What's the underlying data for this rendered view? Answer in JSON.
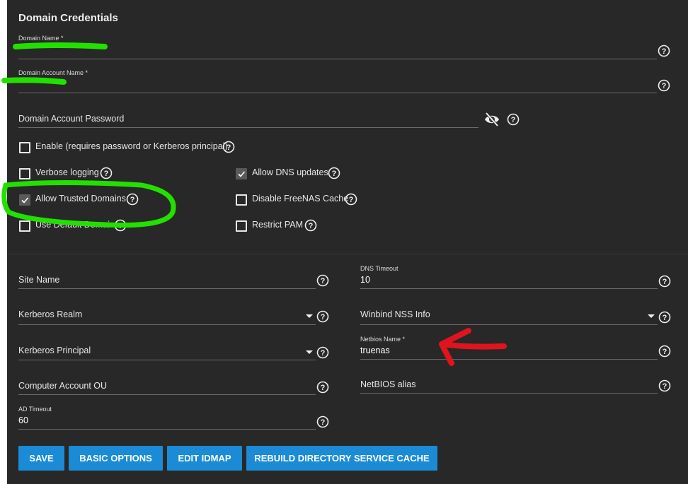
{
  "section": {
    "title": "Domain Credentials"
  },
  "fields": {
    "domain_name": {
      "label": "Domain Name *",
      "value": ""
    },
    "domain_account_name": {
      "label": "Domain Account Name *",
      "value": ""
    },
    "domain_account_password": {
      "label": "Domain Account Password",
      "value": ""
    },
    "site_name": {
      "label": "Site Name",
      "value": ""
    },
    "dns_timeout": {
      "label": "DNS Timeout",
      "value": "10"
    },
    "kerberos_realm": {
      "label": "Kerberos Realm",
      "value": ""
    },
    "winbind_nss_info": {
      "label": "Winbind NSS Info",
      "value": ""
    },
    "kerberos_principal": {
      "label": "Kerberos Principal",
      "value": ""
    },
    "netbios_name": {
      "label": "Netbios Name *",
      "value": "truenas"
    },
    "computer_account_ou": {
      "label": "Computer Account OU",
      "value": ""
    },
    "netbios_alias": {
      "label": "NetBIOS alias",
      "value": ""
    },
    "ad_timeout": {
      "label": "AD Timeout",
      "value": "60"
    }
  },
  "checkboxes": {
    "enable": {
      "label": "Enable (requires password or Kerberos principal)",
      "checked": false
    },
    "verbose_logging": {
      "label": "Verbose logging",
      "checked": false
    },
    "allow_dns_updates": {
      "label": "Allow DNS updates",
      "checked": true
    },
    "allow_trusted_domains": {
      "label": "Allow Trusted Domains",
      "checked": true
    },
    "disable_freenas_cache": {
      "label": "Disable FreeNAS Cache",
      "checked": false
    },
    "use_default_domain": {
      "label": "Use Default Domain",
      "checked": false
    },
    "restrict_pam": {
      "label": "Restrict PAM",
      "checked": false
    }
  },
  "buttons": {
    "save": "SAVE",
    "basic_options": "BASIC OPTIONS",
    "edit_idmap": "EDIT IDMAP",
    "rebuild_cache": "REBUILD DIRECTORY SERVICE CACHE"
  },
  "icons": {
    "help": "help-circle-icon",
    "password_toggle": "eye-off-icon",
    "dropdown": "caret-down-icon"
  },
  "colors": {
    "panel_bg": "#282828",
    "button_bg": "#1b8bd6",
    "annotation_green": "#22e000",
    "annotation_red": "#e0141e"
  }
}
